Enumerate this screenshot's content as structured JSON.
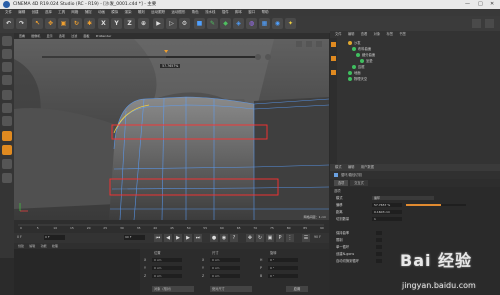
{
  "window": {
    "title": "CINEMA 4D R19.024 Studio (RC - R19) - [沙发_0001.c4d *] - 主要",
    "controls": [
      "—",
      "□",
      "✕"
    ]
  },
  "menu": [
    "文件",
    "编辑",
    "创建",
    "选择",
    "工具",
    "网格",
    "捕捉",
    "动画",
    "模拟",
    "渲染",
    "雕刻",
    "运动跟踪",
    "运动图形",
    "角色",
    "流水线",
    "插件",
    "脚本",
    "窗口",
    "帮助"
  ],
  "toolbar": {
    "letters": [
      "X",
      "Y",
      "Z"
    ]
  },
  "viewport": {
    "tabs": [
      "查看",
      "摄像机",
      "显示",
      "选项",
      "过滤",
      "面板",
      "ProRender"
    ],
    "progress_label": "57.7657%",
    "progress_fraction": 0.577,
    "status_text": "网格间距：1 cm"
  },
  "timeline": {
    "ticks": [
      "0",
      "5",
      "10",
      "15",
      "20",
      "25",
      "30",
      "35",
      "40",
      "45",
      "50",
      "55",
      "60",
      "65",
      "70",
      "75",
      "80",
      "85",
      "90"
    ],
    "frame_left": "0 F",
    "frame_field_1": "0 F",
    "frame_field_2": "90 F",
    "frame_right": "90 F"
  },
  "materials": {
    "tabs": [
      "创建",
      "编辑",
      "功能",
      "纹理"
    ]
  },
  "coords": {
    "headers": [
      "位置",
      "尺寸",
      "旋转"
    ],
    "rows": [
      {
        "axis": "X",
        "pos": "0 cm",
        "size": "0 cm",
        "rot_label": "H",
        "rot": "0 °"
      },
      {
        "axis": "Y",
        "pos": "0 cm",
        "size": "0 cm",
        "rot_label": "P",
        "rot": "0 °"
      },
      {
        "axis": "Z",
        "pos": "0 cm",
        "size": "0 cm",
        "rot_label": "B",
        "rot": "0 °"
      }
    ],
    "mode_left": "对象（相对）",
    "mode_right": "绝对尺寸",
    "apply_label": "应用"
  },
  "objects": {
    "tabs": [
      "文件",
      "编辑",
      "查看",
      "对象",
      "标签",
      "书签"
    ],
    "items": [
      {
        "name": "沙发",
        "color": "#e0a830"
      },
      {
        "name": "布料曲面",
        "color": "#3fbf5f"
      },
      {
        "name": "细分曲面",
        "color": "#3fbf5f"
      },
      {
        "name": "坐垫",
        "color": "#3fbf5f"
      },
      {
        "name": "边框",
        "color": "#3fbf5f"
      },
      {
        "name": "地面",
        "color": "#3fbf5f"
      },
      {
        "name": "物理天空",
        "color": "#3fbf5f"
      }
    ]
  },
  "attributes": {
    "header_tabs": [
      "模式",
      "编辑",
      "用户数据"
    ],
    "title": "循环/路径切割",
    "tabs": [
      "选项",
      "交互式"
    ],
    "section": "选项",
    "rows": [
      {
        "label": "模式",
        "value": "循环"
      },
      {
        "label": "偏移",
        "value": "57.7657 %"
      },
      {
        "label": "距离",
        "value": "0.1603 cm"
      },
      {
        "label": "切割数量",
        "value": "1"
      },
      {
        "label": "保持曲率",
        "value": ""
      },
      {
        "label": "限制",
        "value": ""
      },
      {
        "label": "单一循环",
        "value": ""
      },
      {
        "label": "创建N-gons",
        "value": ""
      },
      {
        "label": "自动切换到循环",
        "value": ""
      }
    ]
  },
  "watermark": {
    "logo": "Bai 经验",
    "url": "jingyan.baidu.com"
  }
}
